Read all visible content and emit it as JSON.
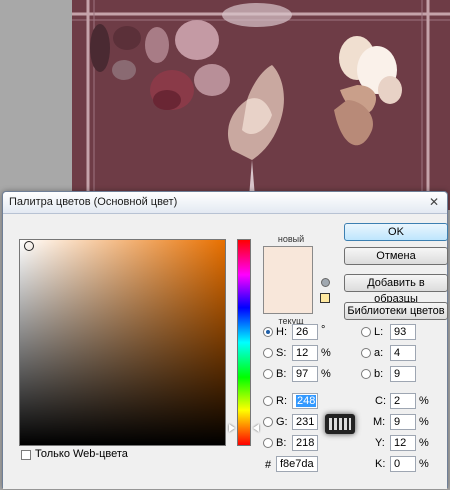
{
  "dialog": {
    "title": "Палитра цветов (Основной цвет)",
    "close_glyph": "✕"
  },
  "swatch": {
    "new_label": "новый",
    "current_label": "текущ",
    "new_color": "#f8e7da",
    "current_color": "#f8e7da"
  },
  "buttons": {
    "ok": "OK",
    "cancel": "Отмена",
    "add": "Добавить в образцы",
    "libraries": "Библиотеки цветов"
  },
  "hsb": {
    "h_label": "H:",
    "h": "26",
    "h_unit": "°",
    "s_label": "S:",
    "s": "12",
    "s_unit": "%",
    "b_label": "B:",
    "b": "97",
    "b_unit": "%"
  },
  "rgb": {
    "r_label": "R:",
    "r": "248",
    "g_label": "G:",
    "g": "231",
    "b_label": "B:",
    "b": "218"
  },
  "lab": {
    "l_label": "L:",
    "l": "93",
    "a_label": "a:",
    "a": "4",
    "b_label": "b:",
    "b": "9"
  },
  "cmyk": {
    "c_label": "C:",
    "c": "2",
    "c_unit": "%",
    "m_label": "M:",
    "m": "9",
    "m_unit": "%",
    "y_label": "Y:",
    "y": "12",
    "y_unit": "%",
    "k_label": "K:",
    "k": "0",
    "k_unit": "%"
  },
  "hex": {
    "label": "#",
    "value": "f8e7da"
  },
  "web_only": {
    "label": "Только Web-цвета",
    "checked": false
  },
  "colors": {
    "canvas": "#6e3c46",
    "field_hue": "#e87000",
    "ok_border": "#3c7fb1"
  }
}
